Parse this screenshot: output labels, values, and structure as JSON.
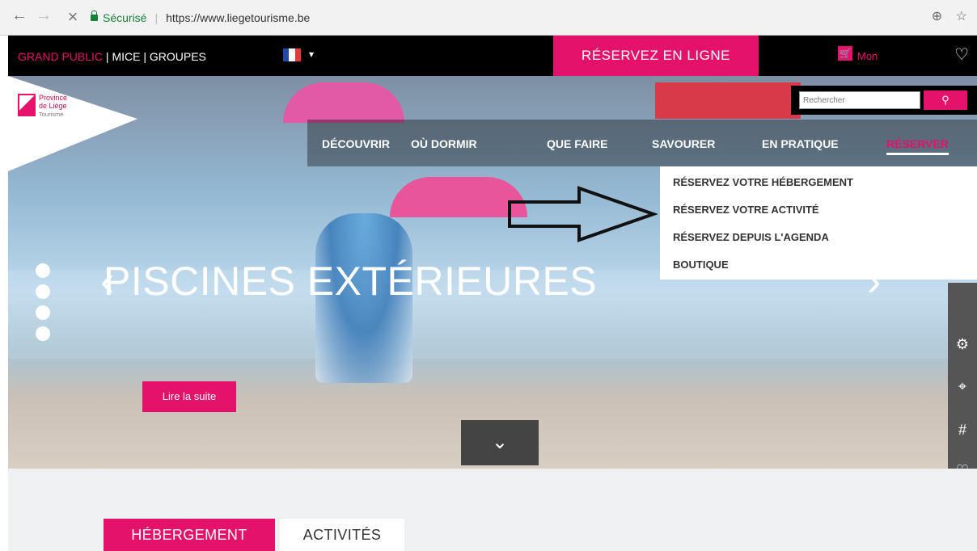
{
  "browser": {
    "secure_label": "Sécurisé",
    "url": "https://www.liegetourisme.be"
  },
  "topbar": {
    "grand_public": "GRAND PUBLIC",
    "links": " | MICE | GROUPES",
    "reserve_online": "RÉSERVEZ EN LIGNE",
    "cart_label": "Mon"
  },
  "logo": {
    "line1": "Province",
    "line2": "de Liège",
    "line3": "Tourisme"
  },
  "search": {
    "placeholder": "Rechercher",
    "button_icon": "search-icon"
  },
  "main_nav": [
    {
      "label": "DÉCOUVRIR"
    },
    {
      "label": "OÙ DORMIR"
    },
    {
      "label": "QUE FAIRE"
    },
    {
      "label": "SAVOURER"
    },
    {
      "label": "EN PRATIQUE"
    },
    {
      "label": "RÉSERVER",
      "active": true
    }
  ],
  "dropdown": [
    {
      "label": "RÉSERVEZ VOTRE HÉBERGEMENT"
    },
    {
      "label": "RÉSERVEZ VOTRE ACTIVITÉ"
    },
    {
      "label": "RÉSERVEZ DEPUIS L'AGENDA"
    },
    {
      "label": "BOUTIQUE"
    }
  ],
  "hero": {
    "title": "PISCINES EXTÉRIEURES",
    "read_more": "Lire la suite"
  },
  "tabs": {
    "hebergement": "HÉBERGEMENT",
    "activites": "ACTIVITÉS"
  },
  "colors": {
    "accent": "#e4126b",
    "topbar": "#000000"
  }
}
